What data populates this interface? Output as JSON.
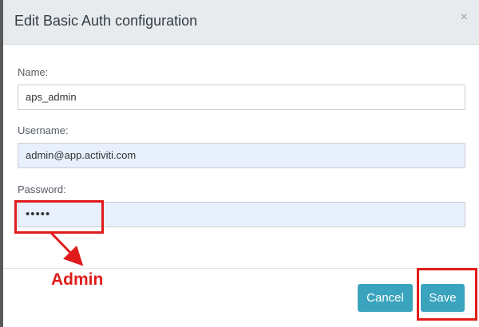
{
  "dialog": {
    "title": "Edit Basic Auth configuration",
    "close_icon": "×"
  },
  "form": {
    "name_label": "Name:",
    "name_value": "aps_admin",
    "username_label": "Username:",
    "username_value": "admin@app.activiti.com",
    "password_label": "Password:",
    "password_value": "•••••"
  },
  "footer": {
    "cancel_label": "Cancel",
    "save_label": "Save"
  },
  "annotation": {
    "text": "Admin",
    "color": "#e11b1b"
  },
  "colors": {
    "button": "#3aa3bd",
    "header": "#e7ebee",
    "autofill": "#e8f0fe"
  }
}
